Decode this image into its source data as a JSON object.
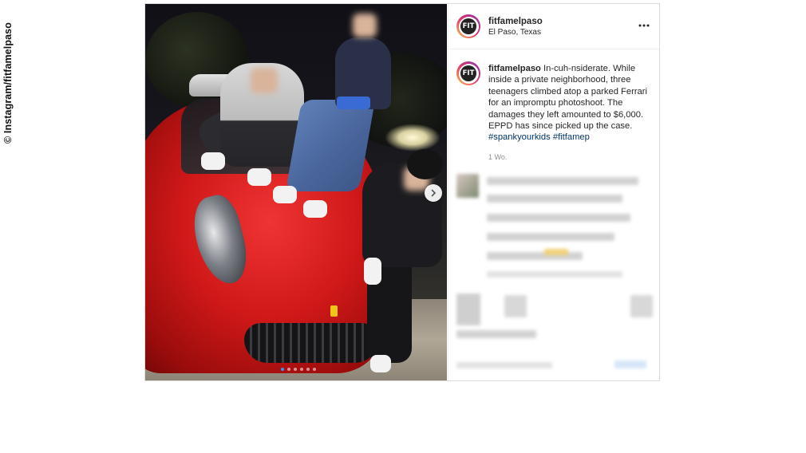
{
  "credit": "© Instagram/fitfamelpaso",
  "post": {
    "account": "fitfamelpaso",
    "location": "El Paso, Texas",
    "avatar_text": "FIT",
    "more_icon": "more-horizontal-icon",
    "caption": {
      "username": "fitfamelpaso",
      "text": "In-cuh-nsiderate. While inside a private neighborhood, three teenagers climbed atop a parked Ferrari for an impromptu photoshoot. The damages they left amounted to $6,000. EPPD has since picked up the case.",
      "hashtags": [
        "#spankyourkids",
        "#fitfamep"
      ]
    },
    "timestamp": "1 Wo.",
    "carousel": {
      "current": 1,
      "total": 6,
      "next_icon": "chevron-right-icon"
    }
  },
  "colors": {
    "accent": "#3897f0",
    "hashtag": "#003569",
    "border": "#dbdbdb"
  }
}
